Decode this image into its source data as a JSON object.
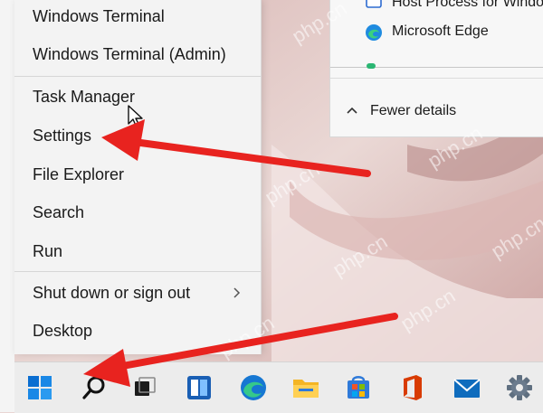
{
  "task_manager": {
    "processes": [
      {
        "label": "Host Process for Windows",
        "icon": "process-icon"
      },
      {
        "label": "Microsoft Edge",
        "icon": "edge-icon"
      }
    ],
    "fewer_details_label": "Fewer details"
  },
  "context_menu": {
    "items": [
      {
        "label": "Windows Terminal"
      },
      {
        "label": "Windows Terminal (Admin)"
      },
      {
        "label": "Task Manager"
      },
      {
        "label": "Settings"
      },
      {
        "label": "File Explorer"
      },
      {
        "label": "Search"
      },
      {
        "label": "Run"
      },
      {
        "label": "Shut down or sign out",
        "has_submenu": true
      },
      {
        "label": "Desktop"
      }
    ]
  },
  "taskbar": {
    "buttons": [
      {
        "name": "start",
        "icon": "windows-logo-icon"
      },
      {
        "name": "search",
        "icon": "search-icon"
      },
      {
        "name": "task-view",
        "icon": "task-view-icon"
      },
      {
        "name": "widgets",
        "icon": "widgets-icon"
      },
      {
        "name": "edge",
        "icon": "edge-icon"
      },
      {
        "name": "file-explorer",
        "icon": "folder-icon"
      },
      {
        "name": "store",
        "icon": "store-icon"
      },
      {
        "name": "office",
        "icon": "office-icon"
      },
      {
        "name": "mail",
        "icon": "mail-icon"
      },
      {
        "name": "settings",
        "icon": "gear-icon"
      }
    ]
  },
  "watermark": "php.cn",
  "colors": {
    "annotation_arrow": "#e8231f",
    "windows_blue": "#0078d4",
    "menu_bg": "#f3f3f3",
    "taskbar_bg": "#ececec"
  }
}
